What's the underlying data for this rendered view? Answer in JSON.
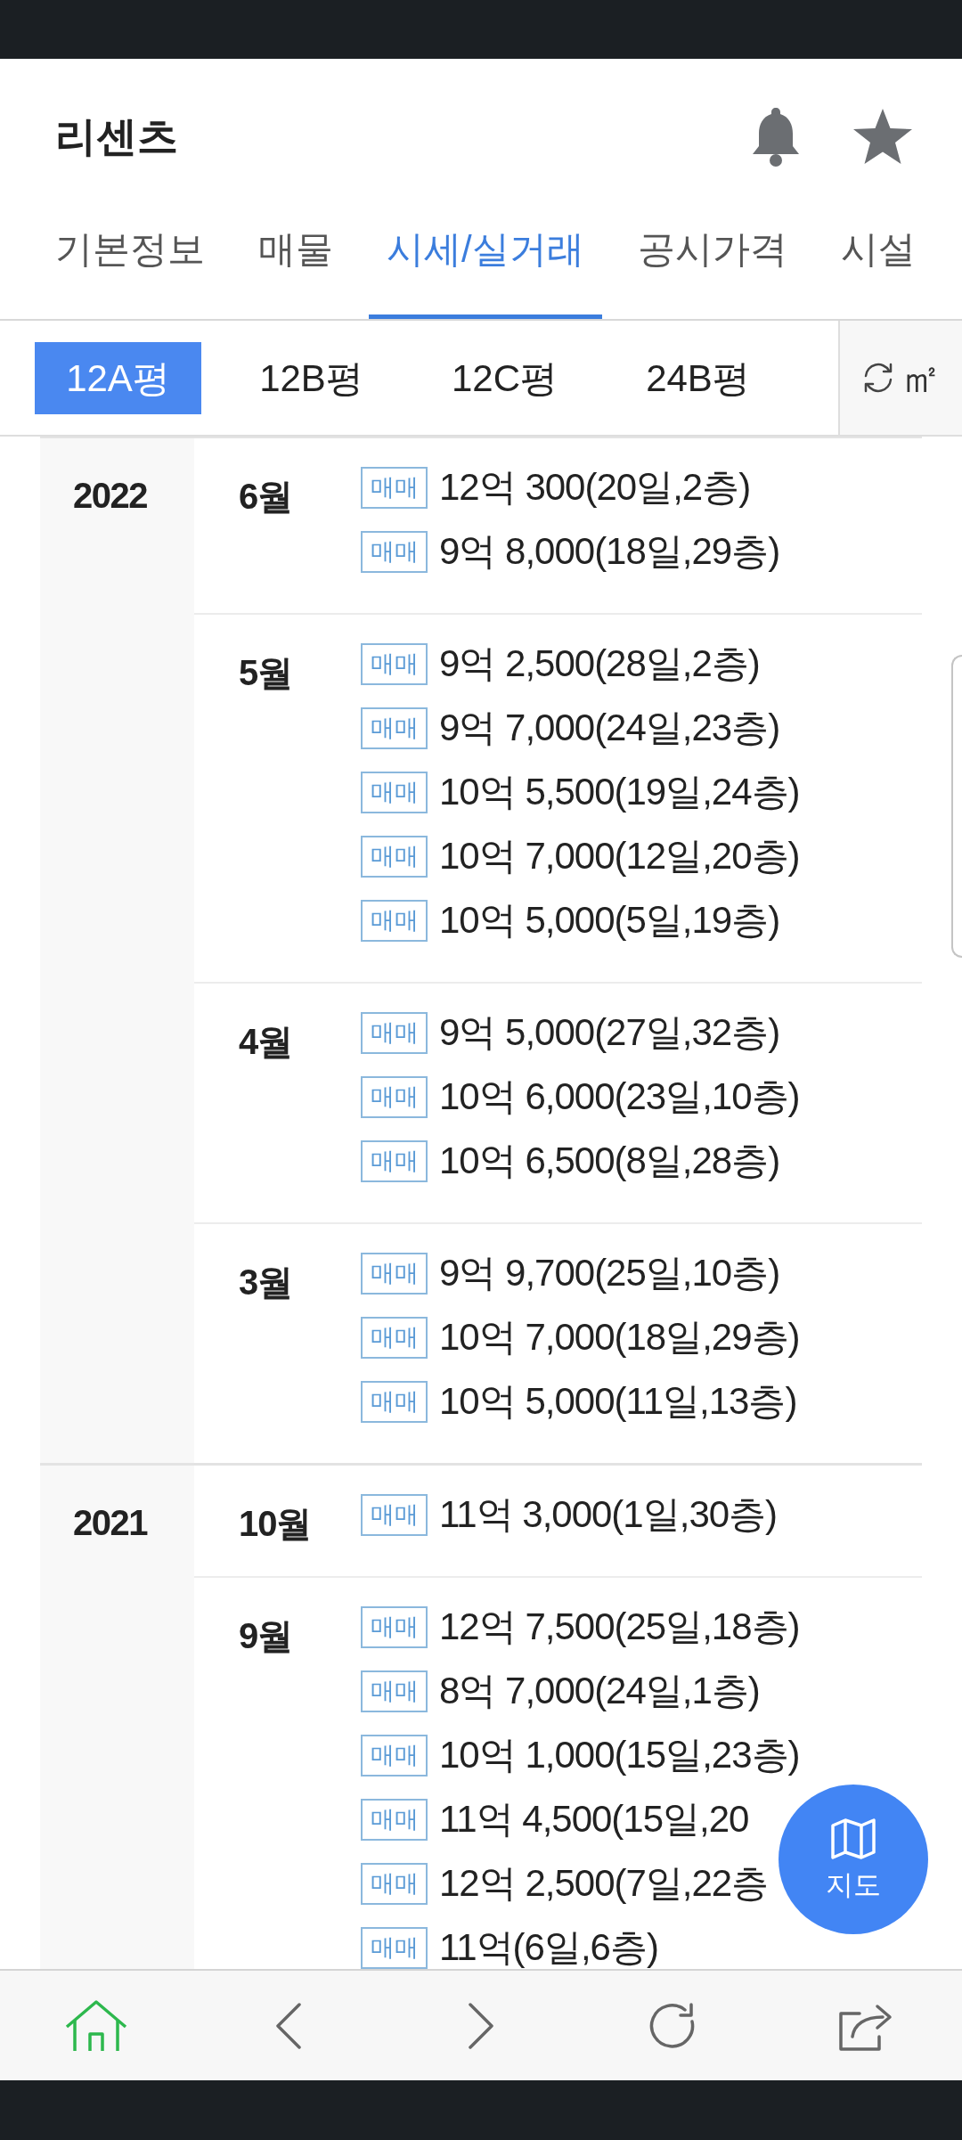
{
  "app_bar": {
    "title": "리센츠"
  },
  "tabs": [
    {
      "label": "기본정보",
      "selected": false
    },
    {
      "label": "매물",
      "selected": false
    },
    {
      "label": "시세/실거래",
      "selected": true
    },
    {
      "label": "공시가격",
      "selected": false
    },
    {
      "label": "시설",
      "selected": false
    }
  ],
  "size_tabs": [
    {
      "label": "12A평",
      "selected": true
    },
    {
      "label": "12B평",
      "selected": false
    },
    {
      "label": "12C평",
      "selected": false
    },
    {
      "label": "24B평",
      "selected": false
    }
  ],
  "unit_toggle": {
    "label": "㎡"
  },
  "transactions": [
    {
      "year": "2022",
      "months": [
        {
          "month": "6월",
          "deals": [
            {
              "deal_type": "매매",
              "price": "12억 300(20일,2층)"
            },
            {
              "deal_type": "매매",
              "price": "9억 8,000(18일,29층)"
            }
          ]
        },
        {
          "month": "5월",
          "deals": [
            {
              "deal_type": "매매",
              "price": "9억 2,500(28일,2층)"
            },
            {
              "deal_type": "매매",
              "price": "9억 7,000(24일,23층)"
            },
            {
              "deal_type": "매매",
              "price": "10억 5,500(19일,24층)"
            },
            {
              "deal_type": "매매",
              "price": "10억 7,000(12일,20층)"
            },
            {
              "deal_type": "매매",
              "price": "10억 5,000(5일,19층)"
            }
          ]
        },
        {
          "month": "4월",
          "deals": [
            {
              "deal_type": "매매",
              "price": "9억 5,000(27일,32층)"
            },
            {
              "deal_type": "매매",
              "price": "10억 6,000(23일,10층)"
            },
            {
              "deal_type": "매매",
              "price": "10억 6,500(8일,28층)"
            }
          ]
        },
        {
          "month": "3월",
          "deals": [
            {
              "deal_type": "매매",
              "price": "9억 9,700(25일,10층)"
            },
            {
              "deal_type": "매매",
              "price": "10억 7,000(18일,29층)"
            },
            {
              "deal_type": "매매",
              "price": "10억 5,000(11일,13층)"
            }
          ]
        }
      ]
    },
    {
      "year": "2021",
      "months": [
        {
          "month": "10월",
          "deals": [
            {
              "deal_type": "매매",
              "price": "11억 3,000(1일,30층)"
            }
          ]
        },
        {
          "month": "9월",
          "deals": [
            {
              "deal_type": "매매",
              "price": "12억 7,500(25일,18층)"
            },
            {
              "deal_type": "매매",
              "price": "8억 7,000(24일,1층)"
            },
            {
              "deal_type": "매매",
              "price": "10억 1,000(15일,23층)"
            },
            {
              "deal_type": "매매",
              "price": "11억 4,500(15일,20"
            },
            {
              "deal_type": "매매",
              "price": "12억 2,500(7일,22층"
            },
            {
              "deal_type": "매매",
              "price": "11억(6일,6층)"
            }
          ]
        }
      ]
    }
  ],
  "map_button": {
    "label": "지도"
  }
}
